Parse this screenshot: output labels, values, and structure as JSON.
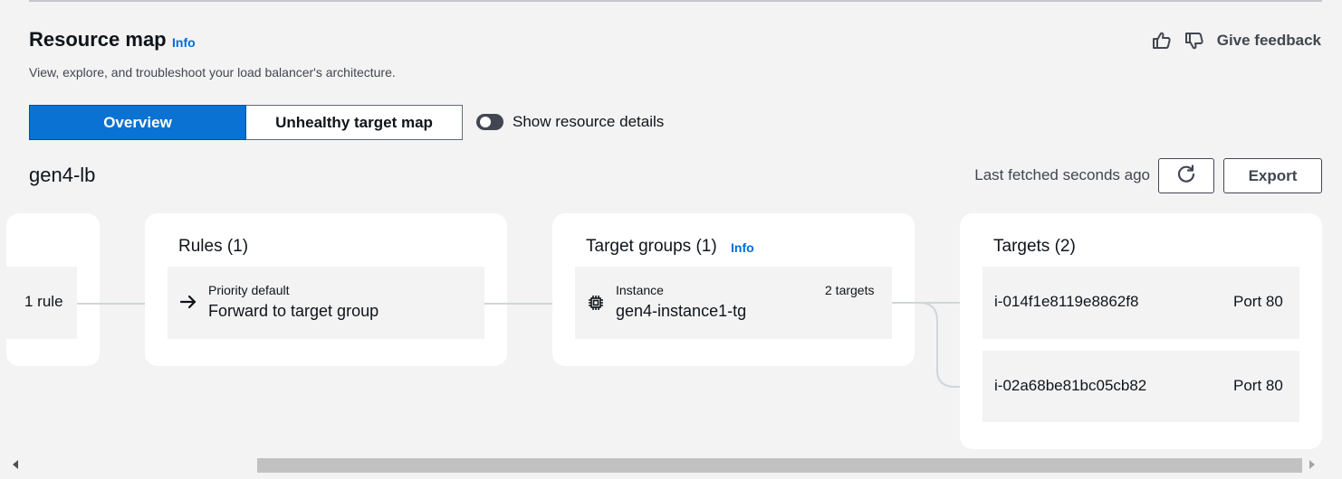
{
  "header": {
    "title": "Resource map",
    "info_label": "Info",
    "subtitle": "View, explore, and troubleshoot your load balancer's architecture.",
    "feedback_label": "Give feedback",
    "feedback_icons": [
      "thumbs-up-icon",
      "thumbs-down-icon"
    ]
  },
  "tabs": {
    "items": [
      {
        "label": "Overview",
        "selected": true
      },
      {
        "label": "Unhealthy target map",
        "selected": false
      }
    ]
  },
  "toggle": {
    "label": "Show resource details",
    "checked": false
  },
  "load_balancer": {
    "name": "gen4-lb",
    "last_fetched": "Last fetched seconds ago",
    "refresh_icon": "refresh-icon",
    "export_label": "Export"
  },
  "listeners": {
    "rule_label": "1 rule"
  },
  "rules": {
    "title": "Rules (1)",
    "node": {
      "priority": "Priority default",
      "action": "Forward to target group",
      "icon": "arrow-right-icon"
    }
  },
  "target_groups": {
    "title": "Target groups (1)",
    "info_label": "Info",
    "node": {
      "type": "Instance",
      "name": "gen4-instance1-tg",
      "target_count": "2 targets",
      "icon": "chip-icon"
    }
  },
  "targets": {
    "title": "Targets (2)",
    "items": [
      {
        "id": "i-014f1e8119e8862f8",
        "port": "Port 80"
      },
      {
        "id": "i-02a68be81bc05cb82",
        "port": "Port 80"
      }
    ]
  },
  "colors": {
    "accent": "#0972d3",
    "link": "#006ce0",
    "panel": "#ffffff",
    "background": "#f3f3f3",
    "connector": "#d1d5db"
  }
}
